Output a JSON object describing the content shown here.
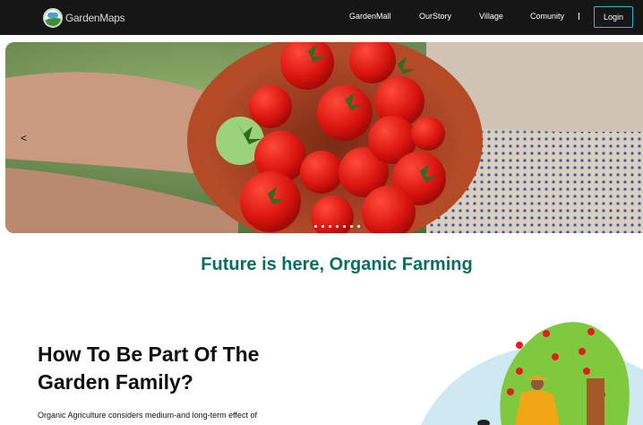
{
  "brand": {
    "name": "GardenMaps"
  },
  "nav": {
    "links": [
      "GardenMall",
      "OurStory",
      "Village",
      "Comunity"
    ],
    "login_label": "Login"
  },
  "hero": {
    "prev_glyph": "<",
    "slide_count": 7,
    "active_slide": 1
  },
  "tagline": "Future is here, Organic Farming",
  "section": {
    "title": "How To Be Part Of The Garden Family?",
    "text": "Organic Agriculture considers medium-and long-term effect of"
  },
  "colors": {
    "nav_bg": "#161616",
    "accent_teal": "#0a6e67",
    "login_border": "#36b7c8"
  }
}
